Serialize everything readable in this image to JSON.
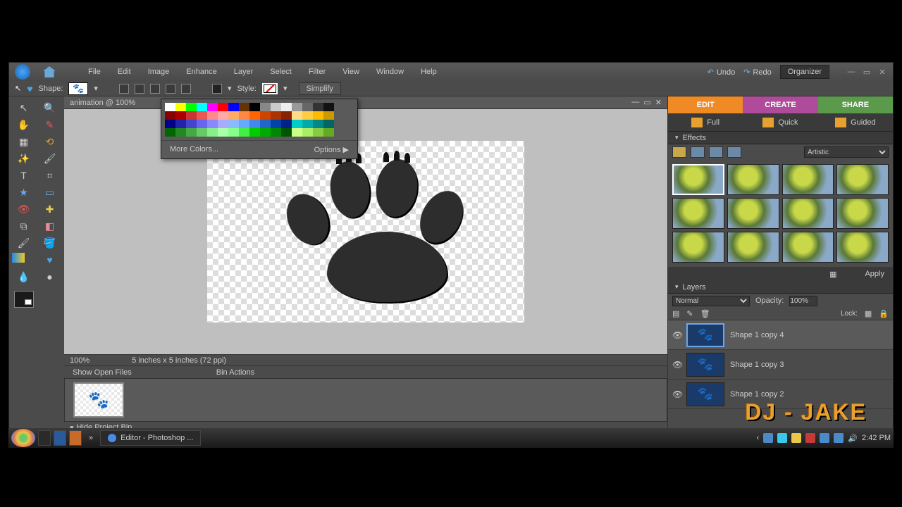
{
  "menubar": {
    "items": [
      "File",
      "Edit",
      "Image",
      "Enhance",
      "Layer",
      "Select",
      "Filter",
      "View",
      "Window",
      "Help"
    ],
    "undo": "Undo",
    "redo": "Redo",
    "organizer": "Organizer"
  },
  "optbar": {
    "shape_label": "Shape:",
    "style_label": "Style:",
    "simplify": "Simplify"
  },
  "doc": {
    "title": "animation @ 100% ",
    "zoom": "100%",
    "dims": "5 inches x 5 inches (72 ppi)"
  },
  "color_popup": {
    "more": "More Colors...",
    "options": "Options  ▶",
    "rows": [
      [
        "#fff",
        "#ff0",
        "#0f0",
        "#0ff",
        "#f0f",
        "#f00",
        "#00f",
        "#630",
        "#000",
        "#888",
        "#ccc",
        "#eee",
        "#999",
        "#666",
        "#333",
        "#111"
      ],
      [
        "#800",
        "#a00",
        "#c33",
        "#e55",
        "#f88",
        "#faa",
        "#fa6",
        "#f84",
        "#f60",
        "#c40",
        "#a30",
        "#820",
        "#fd8",
        "#fc4",
        "#fb0",
        "#c90"
      ],
      [
        "#008",
        "#22a",
        "#44c",
        "#66e",
        "#88f",
        "#aaf",
        "#8bf",
        "#6af",
        "#48e",
        "#26c",
        "#04a",
        "#028",
        "#0cc",
        "#0aa",
        "#088",
        "#066"
      ],
      [
        "#060",
        "#282",
        "#4a4",
        "#6c6",
        "#8e8",
        "#afa",
        "#8f8",
        "#4e4",
        "#0c0",
        "#0a0",
        "#080",
        "#050",
        "#cf8",
        "#ae6",
        "#8c4",
        "#6a2"
      ]
    ]
  },
  "bin": {
    "show_label": "Show Open Files",
    "actions": "Bin Actions",
    "hide": "Hide Project Bin"
  },
  "modes": {
    "edit": "EDIT",
    "create": "CREATE",
    "share": "SHARE"
  },
  "subtabs": {
    "full": "Full",
    "quick": "Quick",
    "guided": "Guided"
  },
  "panels": {
    "effects": "Effects",
    "layers": "Layers",
    "artistic": "Artistic",
    "apply": "Apply"
  },
  "layers_ctrl": {
    "blend": "Normal",
    "opacity_label": "Opacity:",
    "opacity": "100%",
    "lock": "Lock:"
  },
  "layers": [
    {
      "name": "Shape 1 copy 4",
      "sel": true
    },
    {
      "name": "Shape 1 copy 3",
      "sel": false
    },
    {
      "name": "Shape 1 copy 2",
      "sel": false
    }
  ],
  "taskbar": {
    "app": "Editor - Photoshop ...",
    "time": "2:42 PM"
  },
  "watermark": "DJ - JAKE"
}
